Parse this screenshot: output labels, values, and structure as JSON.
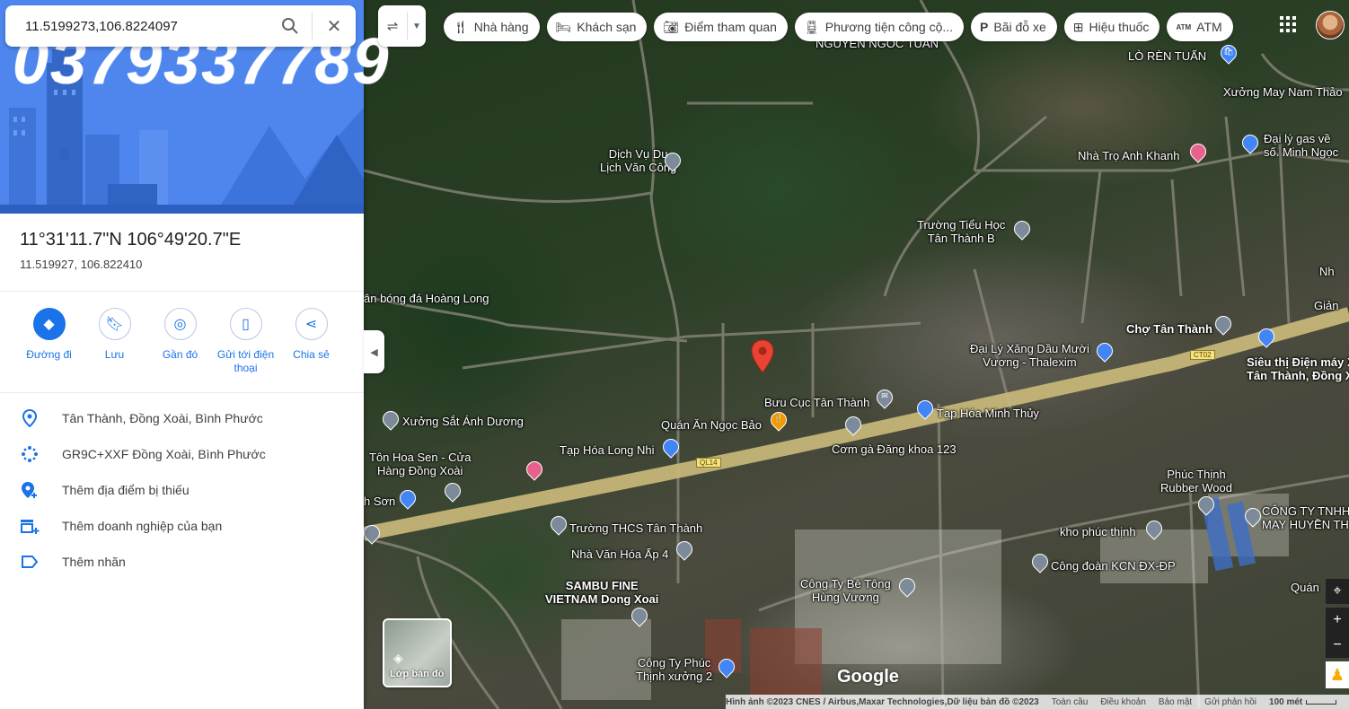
{
  "watermark": "0379337789",
  "search": {
    "value": "11.5199273,106.8224097",
    "search_icon": "search-icon",
    "close_icon": "close-icon"
  },
  "place": {
    "dms": "11°31'11.7\"N 106°49'20.7\"E",
    "decimal": "11.519927, 106.822410"
  },
  "actions": [
    {
      "label": "Đường đi",
      "icon": "directions-icon"
    },
    {
      "label": "Lưu",
      "icon": "bookmark-icon"
    },
    {
      "label": "Gần đó",
      "icon": "nearby-icon"
    },
    {
      "label": "Gửi tới điện thoại",
      "icon": "send-to-phone-icon"
    },
    {
      "label": "Chia sẻ",
      "icon": "share-icon"
    }
  ],
  "info": [
    {
      "text": "Tân Thành, Đồng Xoài, Bình Phước",
      "icon": "location-pin-icon"
    },
    {
      "text": "GR9C+XXF Đồng Xoài, Bình Phước",
      "icon": "plus-code-icon"
    },
    {
      "text": "Thêm địa điểm bị thiếu",
      "icon": "add-place-icon"
    },
    {
      "text": "Thêm doanh nghiệp của bạn",
      "icon": "add-business-icon"
    },
    {
      "text": "Thêm nhãn",
      "icon": "label-icon"
    }
  ],
  "chips": [
    {
      "label": "Nhà hàng",
      "icon": "restaurant-icon"
    },
    {
      "label": "Khách sạn",
      "icon": "hotel-icon"
    },
    {
      "label": "Điểm tham quan",
      "icon": "camera-icon"
    },
    {
      "label": "Phương tiện công cộ...",
      "icon": "transit-icon"
    },
    {
      "label": "Bãi đỗ xe",
      "icon": "parking-icon"
    },
    {
      "label": "Hiệu thuốc",
      "icon": "pharmacy-icon"
    },
    {
      "label": "ATM",
      "icon": "atm-icon"
    }
  ],
  "map_labels": {
    "l1": "NGUYEN NGOC TUAN",
    "l2": "LÒ RÈN TUẤN",
    "l3": "Xưởng May Nam Thảo",
    "l4": "Dịch Vụ Du\nLịch Văn Công",
    "l5": "Nhà Trọ Anh Khanh",
    "l6": "Đại lý gas về\nsố. Minh Ngọc",
    "l7": "Trường Tiểu Học\nTân Thành B",
    "l8": "ân bóng đá Hoàng Long",
    "l9": "Chợ Tân Thành",
    "l10": "Đại Lý Xăng Dầu Mười\nVương - Thalexim",
    "l11": "Siêu thị Điện máy X\nTân Thành, Đồng X",
    "l12": "Bưu Cục Tân Thành",
    "l13": "Quán Ăn Ngọc Bảo",
    "l14": "Tạp Hóa Minh Thủy",
    "l15": "Cơm gà Đăng khoa 123",
    "l16": "Xưởng Sắt Ánh Dương",
    "l17": "Tạp Hóa Long Nhi",
    "l18": "Tôn Hoa Sen - Cửa\nHàng Đồng Xoài",
    "l19": "h Sơn",
    "l20": "Trường THCS Tân Thành",
    "l21": "Nhà Văn Hóa Ấp 4",
    "l22": "Phúc Thịnh\nRubber Wood",
    "l23": "CÔNG TY TNHH\nMAY HUYỀN TH",
    "l24": "kho phúc thịnh",
    "l25": "Công đoàn KCN ĐX-ĐP",
    "l26": "SAMBU FINE\nVIETNAM Dong Xoai",
    "l27": "Công Ty Bê Tông\nHùng Vương",
    "l28": "Công Ty Phúc\nThịnh xưởng 2",
    "l29": "Quán",
    "l30": "Giản",
    "l31": "Nh"
  },
  "road_tags": {
    "r1": "QL14",
    "r2": "CT02"
  },
  "layers_label": "Lớp bản đồ",
  "google_logo": "Google",
  "footer": {
    "imagery": "Hình ảnh ©2023 CNES / Airbus,Maxar Technologies,Dữ liệu bản đồ ©2023",
    "global": "Toàn cầu",
    "terms": "Điều khoản",
    "privacy": "Bảo mật",
    "feedback": "Gửi phản hồi",
    "scale": "100 mét"
  },
  "colors": {
    "accent": "#1a73e8",
    "red_pin": "#ea4335",
    "pin_blue": "#4285f4",
    "pin_gray": "#7d8a99",
    "pin_pink": "#e8618c",
    "pin_orange": "#f29900"
  }
}
